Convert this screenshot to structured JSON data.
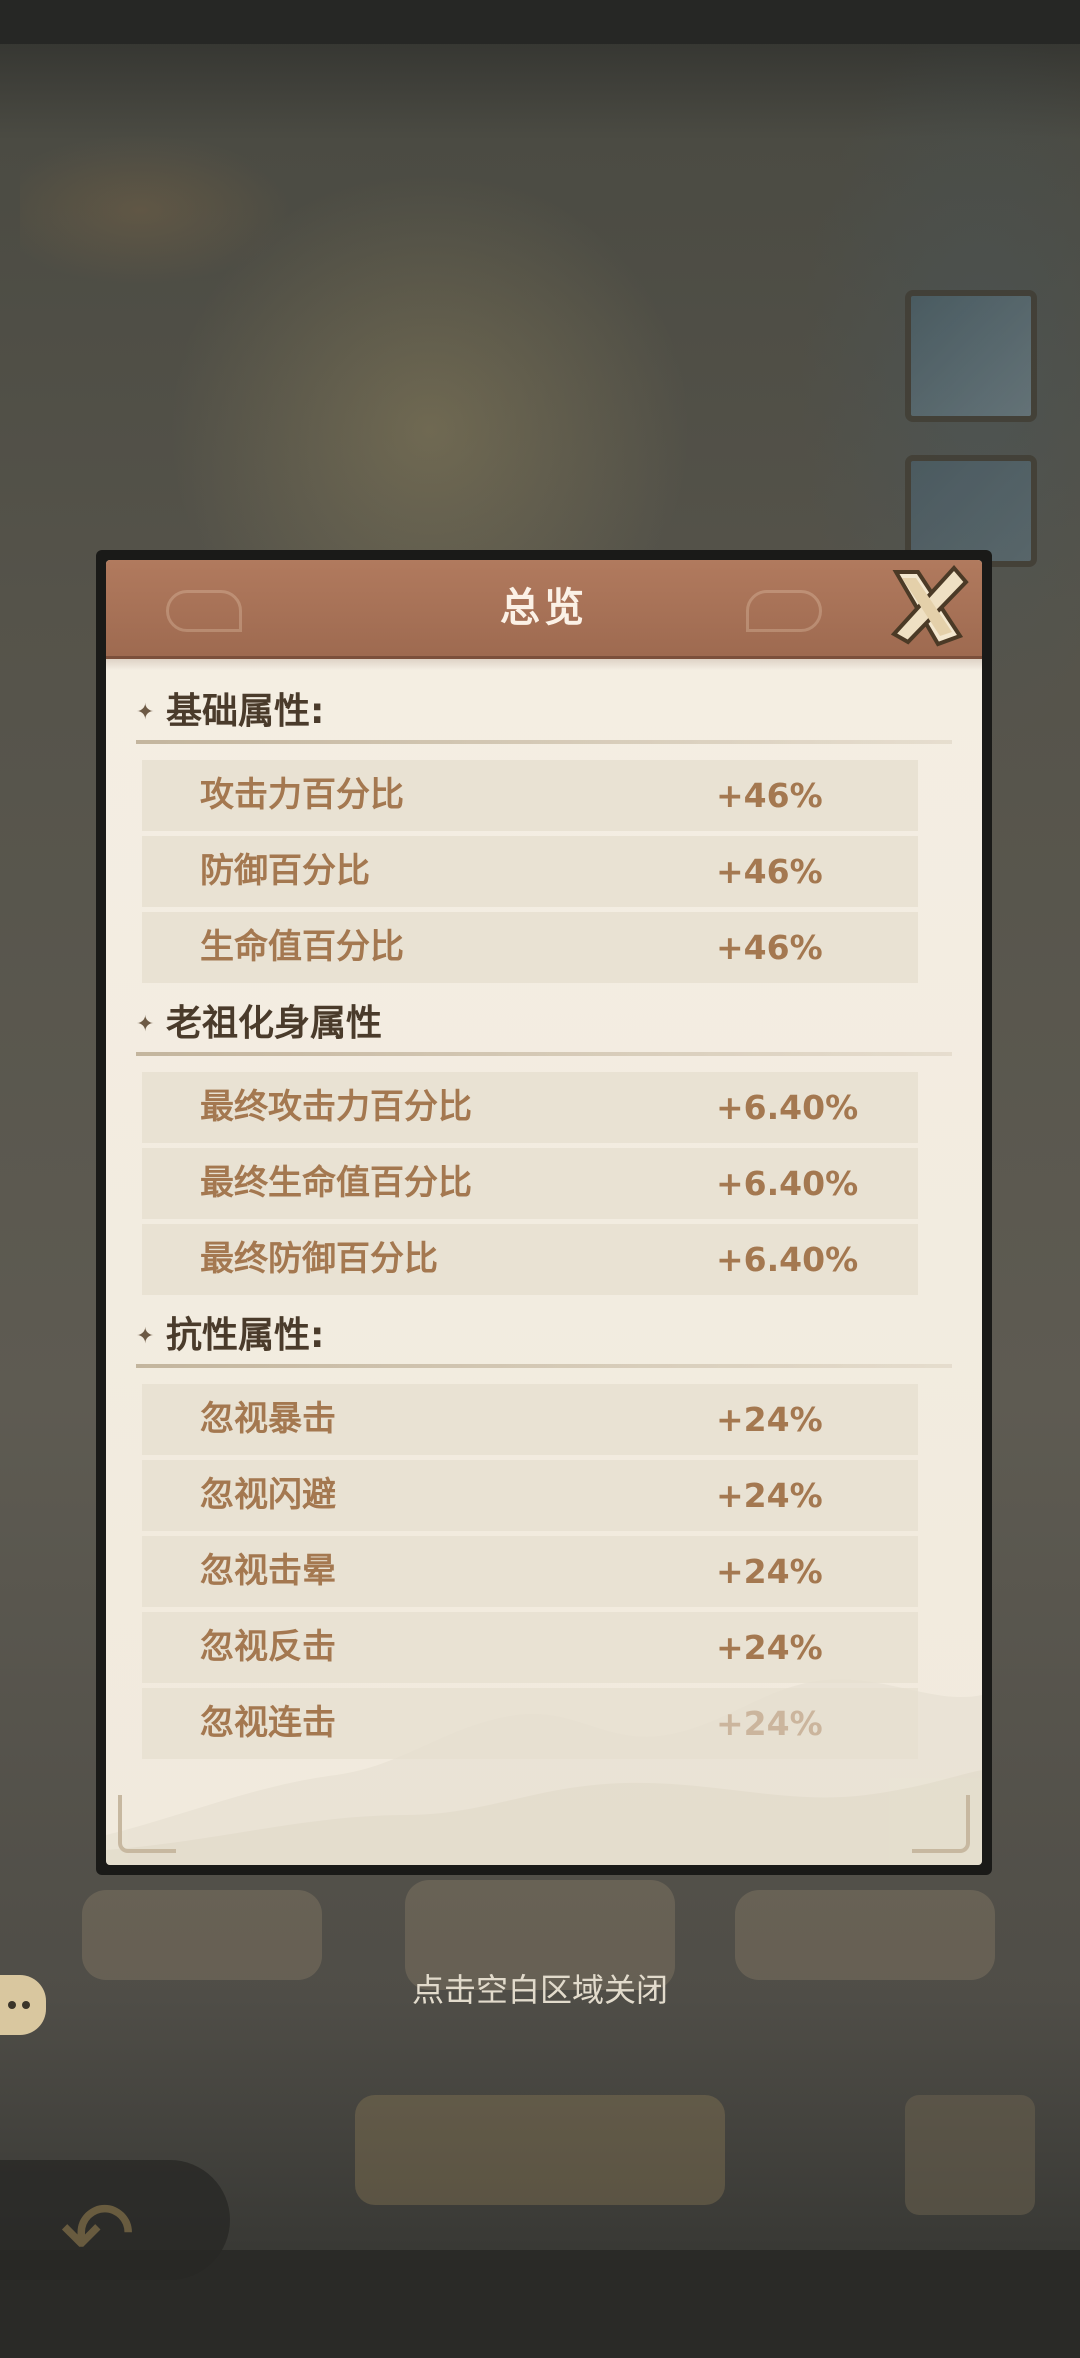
{
  "panel": {
    "title": "总览",
    "close_icon": "x-close-icon"
  },
  "sections": [
    {
      "title": "基础属性:",
      "rows": [
        {
          "label": "攻击力百分比",
          "value": "+46%"
        },
        {
          "label": "防御百分比",
          "value": "+46%"
        },
        {
          "label": "生命值百分比",
          "value": "+46%"
        }
      ]
    },
    {
      "title": "老祖化身属性",
      "rows": [
        {
          "label": "最终攻击力百分比",
          "value": "+6.40%"
        },
        {
          "label": "最终生命值百分比",
          "value": "+6.40%"
        },
        {
          "label": "最终防御百分比",
          "value": "+6.40%"
        }
      ]
    },
    {
      "title": "抗性属性:",
      "rows": [
        {
          "label": "忽视暴击",
          "value": "+24%"
        },
        {
          "label": "忽视闪避",
          "value": "+24%"
        },
        {
          "label": "忽视击晕",
          "value": "+24%"
        },
        {
          "label": "忽视反击",
          "value": "+24%"
        },
        {
          "label": "忽视连击",
          "value": "+24%"
        }
      ]
    }
  ],
  "hint": "点击空白区域关闭",
  "colors": {
    "header": "#a87258",
    "parchment": "#f3ede2",
    "row_bg": "#e9e2d3",
    "accent_text": "#a47850",
    "section_text": "#4a3b2b"
  }
}
